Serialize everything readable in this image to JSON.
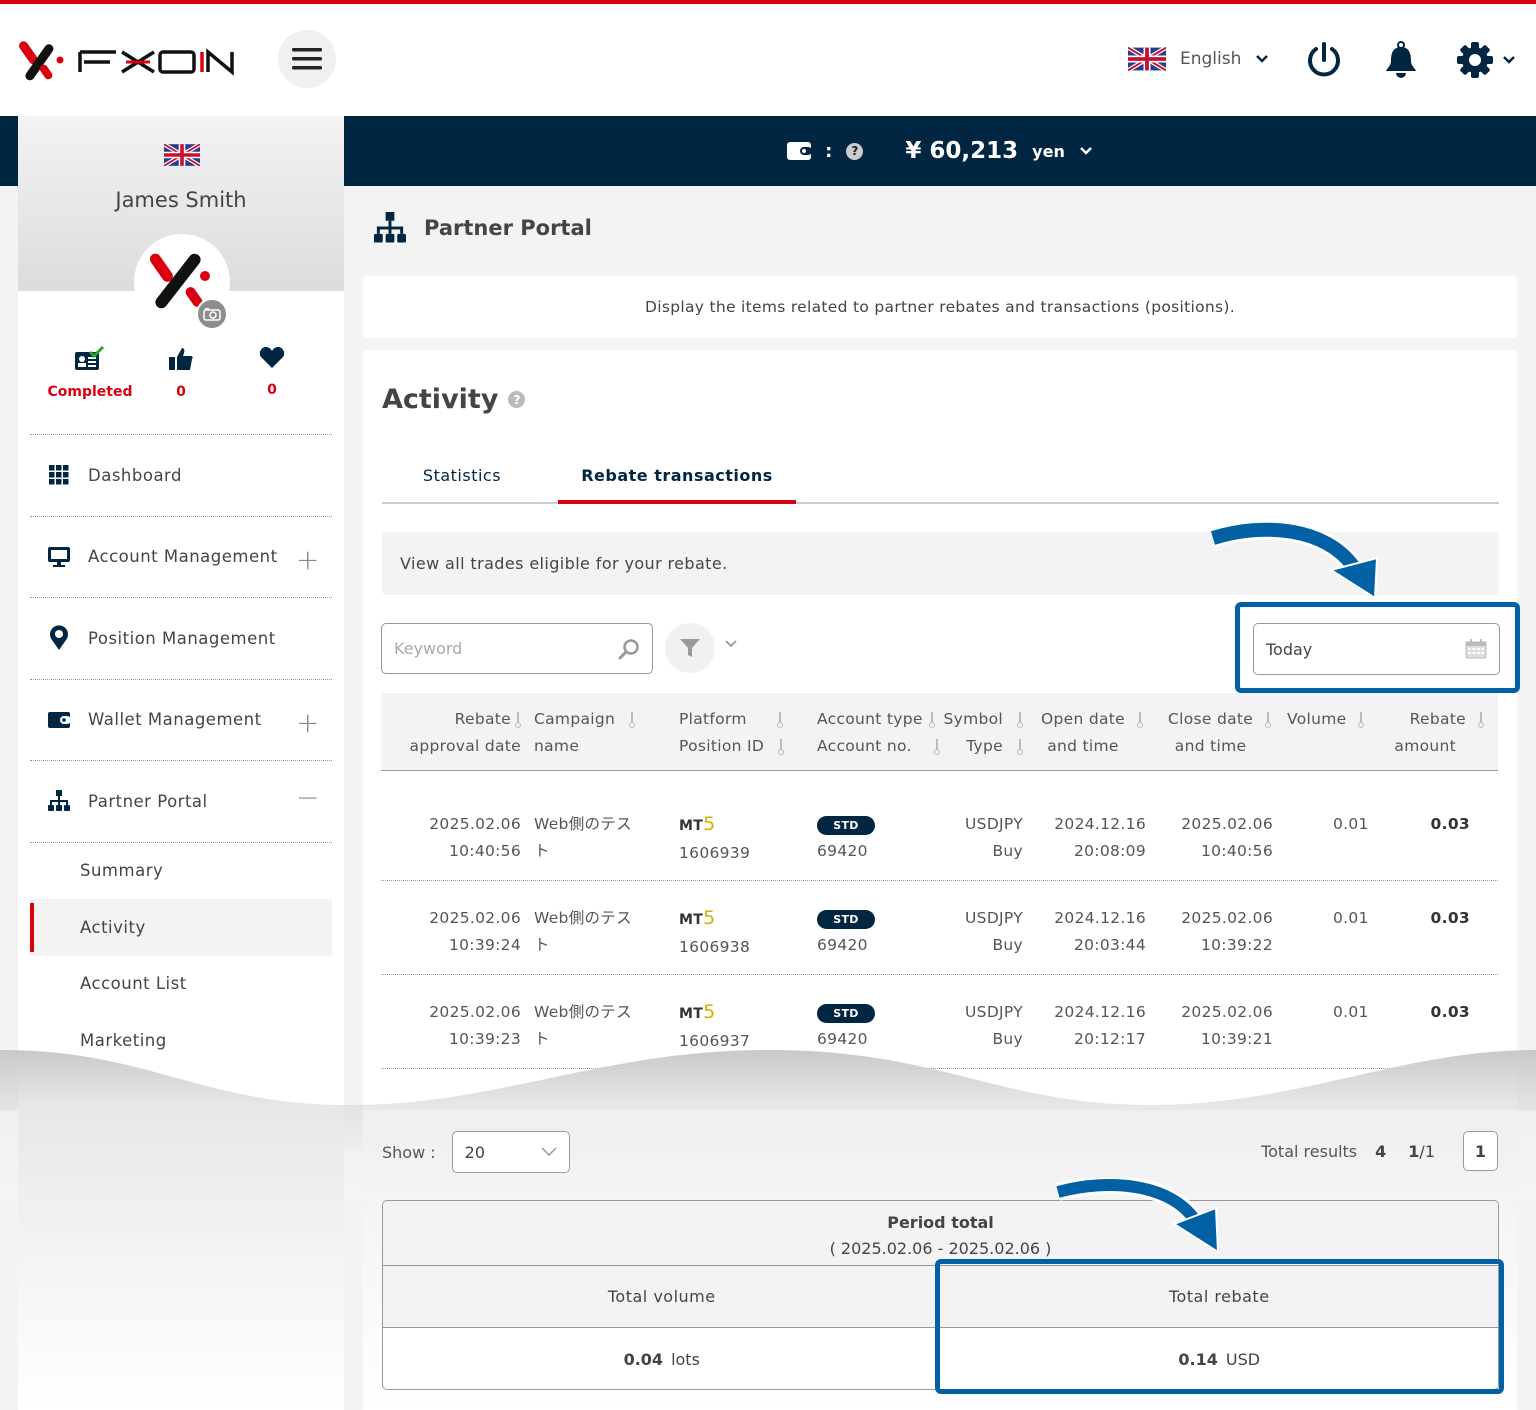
{
  "header": {
    "brand": "FXON",
    "language": "English",
    "icons": [
      "menu-icon",
      "uk-flag-icon",
      "chevron-down-icon",
      "power-icon",
      "bell-icon",
      "gear-icon"
    ]
  },
  "balance": {
    "separator": ":",
    "currency_symbol": "¥",
    "amount": "60,213",
    "unit": "yen"
  },
  "profile": {
    "name": "James Smith",
    "stats": [
      {
        "icon": "id-card-check-icon",
        "value": "Completed"
      },
      {
        "icon": "thumbs-up-icon",
        "value": "0"
      },
      {
        "icon": "heart-icon",
        "value": "0"
      }
    ]
  },
  "sidebar": {
    "items": [
      {
        "label": "Dashboard",
        "icon": "grid-icon",
        "toggle": ""
      },
      {
        "label": "Account Management",
        "icon": "monitor-icon",
        "toggle": "+"
      },
      {
        "label": "Position Management",
        "icon": "map-pin-icon",
        "toggle": ""
      },
      {
        "label": "Wallet Management",
        "icon": "wallet-icon",
        "toggle": "+"
      },
      {
        "label": "Partner Portal",
        "icon": "org-chart-icon",
        "toggle": "−"
      }
    ],
    "subitems": [
      {
        "label": "Summary",
        "active": false
      },
      {
        "label": "Activity",
        "active": true
      },
      {
        "label": "Account List",
        "active": false
      },
      {
        "label": "Marketing",
        "active": false
      }
    ]
  },
  "page": {
    "title": "Partner Portal",
    "description": "Display the items related to partner rebates and transactions (positions)."
  },
  "activity": {
    "title": "Activity",
    "help": "?",
    "tabs": [
      {
        "label": "Statistics",
        "active": false
      },
      {
        "label": "Rebate transactions",
        "active": true
      }
    ],
    "info": "View all trades eligible for your rebate.",
    "keyword_placeholder": "Keyword",
    "date_filter": "Today"
  },
  "table": {
    "headers": [
      {
        "line1": "Rebate",
        "line2": "approval date"
      },
      {
        "line1": "Campaign",
        "line2": "name"
      },
      {
        "line1": "Platform",
        "line2": "Position ID"
      },
      {
        "line1": "Account type",
        "line2": "Account no."
      },
      {
        "line1": "Symbol",
        "line2": "Type"
      },
      {
        "line1": "Open date",
        "line2": "and time"
      },
      {
        "line1": "Close date",
        "line2": "and time"
      },
      {
        "line1": "Volume",
        "line2": ""
      },
      {
        "line1": "Rebate",
        "line2": "amount"
      }
    ],
    "rows": [
      {
        "approval_date": "2025.02.06",
        "approval_time": "10:40:56",
        "campaign1": "Web側のテス",
        "campaign2": "ト",
        "platform": "MT",
        "platform_ver": "5",
        "position_id": "1606939",
        "account_type": "STD",
        "account_no": "69420",
        "symbol": "USDJPY",
        "type": "Buy",
        "open_date": "2024.12.16",
        "open_time": "20:08:09",
        "close_date": "2025.02.06",
        "close_time": "10:40:56",
        "volume": "0.01",
        "rebate": "0.03"
      },
      {
        "approval_date": "2025.02.06",
        "approval_time": "10:39:24",
        "campaign1": "Web側のテス",
        "campaign2": "ト",
        "platform": "MT",
        "platform_ver": "5",
        "position_id": "1606938",
        "account_type": "STD",
        "account_no": "69420",
        "symbol": "USDJPY",
        "type": "Buy",
        "open_date": "2024.12.16",
        "open_time": "20:03:44",
        "close_date": "2025.02.06",
        "close_time": "10:39:22",
        "volume": "0.01",
        "rebate": "0.03"
      },
      {
        "approval_date": "2025.02.06",
        "approval_time": "10:39:23",
        "campaign1": "Web側のテス",
        "campaign2": "ト",
        "platform": "MT",
        "platform_ver": "5",
        "position_id": "1606937",
        "account_type": "STD",
        "account_no": "69420",
        "symbol": "USDJPY",
        "type": "Buy",
        "open_date": "2024.12.16",
        "open_time": "20:12:17",
        "close_date": "2025.02.06",
        "close_time": "10:39:21",
        "volume": "0.01",
        "rebate": "0.03"
      }
    ]
  },
  "pagination": {
    "show_label": "Show :",
    "show_value": "20",
    "total_label": "Total results",
    "total": "4",
    "page_current": "1",
    "page_total": "/1",
    "page_button": "1"
  },
  "period_total": {
    "title": "Period total",
    "range": "( 2025.02.06 - 2025.02.06 )",
    "volume_label": "Total volume",
    "volume_value": "0.04",
    "volume_unit": "lots",
    "rebate_label": "Total rebate",
    "rebate_value": "0.14",
    "rebate_unit": "USD"
  },
  "colors": {
    "brand_red": "#d9000f",
    "navy": "#002642",
    "highlight_blue": "#0261a5"
  }
}
